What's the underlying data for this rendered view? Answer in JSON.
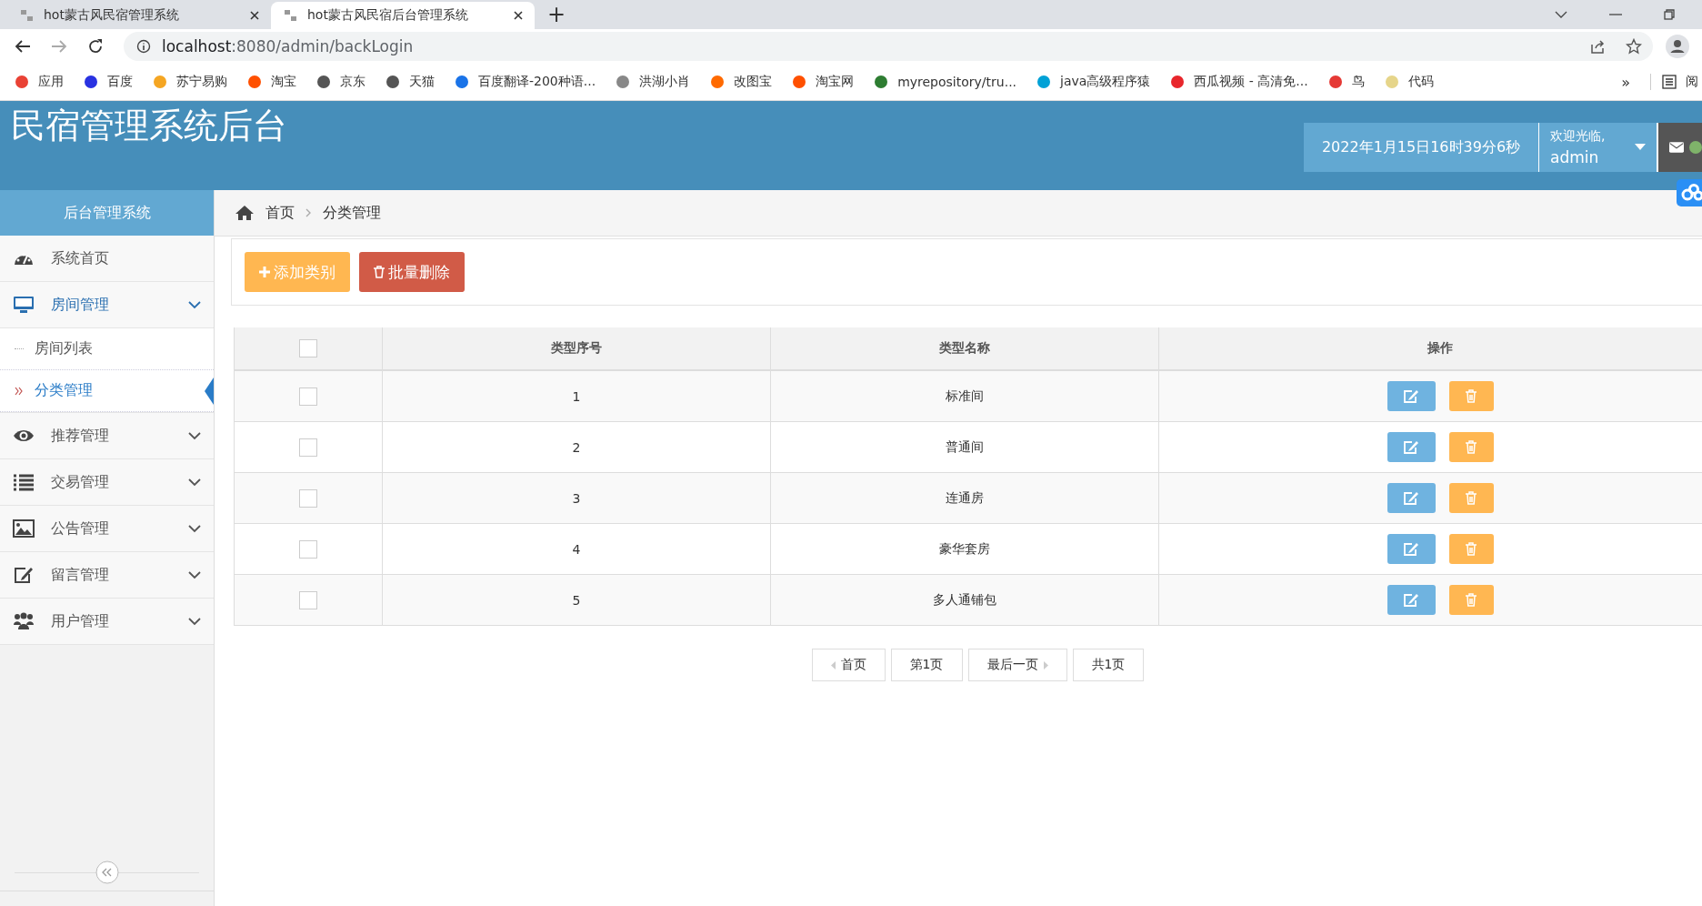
{
  "browser": {
    "tabs": [
      {
        "title": "hot蒙古风民宿管理系统",
        "selected": false
      },
      {
        "title": "hot蒙古风民宿后台管理系统",
        "selected": true
      }
    ],
    "new_tab": "+",
    "url": {
      "host": "localhost",
      "path": ":8080/admin/backLogin"
    },
    "bookmarks": [
      {
        "label": "应用",
        "color": "#e94235"
      },
      {
        "label": "百度",
        "color": "#2932e1"
      },
      {
        "label": "苏宁易购",
        "color": "#f5a623"
      },
      {
        "label": "淘宝",
        "color": "#ff5000"
      },
      {
        "label": "京东",
        "color": "#555555"
      },
      {
        "label": "天猫",
        "color": "#555555"
      },
      {
        "label": "百度翻译-200种语...",
        "color": "#1a73e8"
      },
      {
        "label": "洪湖小肖",
        "color": "#888888"
      },
      {
        "label": "改图宝",
        "color": "#ff6a00"
      },
      {
        "label": "淘宝网",
        "color": "#ff5000"
      },
      {
        "label": "myrepository/tru...",
        "color": "#2e7d32"
      },
      {
        "label": "java高级程序猿",
        "color": "#00a1d6"
      },
      {
        "label": "西瓜视频 - 高清免...",
        "color": "#e8262c"
      },
      {
        "label": "鸟",
        "color": "#e53935"
      },
      {
        "label": "代码",
        "color": "#e6d58a"
      }
    ],
    "more": "»",
    "reading_list": "阅"
  },
  "header": {
    "title": "民宿管理系统后台",
    "datetime": "2022年1月15日16时39分6秒",
    "welcome": "欢迎光临,",
    "user": "admin"
  },
  "sidebar": {
    "title": "后台管理系统",
    "items": [
      {
        "label": "系统首页",
        "kind": "gauge",
        "selected": false,
        "collapsible": false
      },
      {
        "label": "房间管理",
        "kind": "monitor",
        "selected": true,
        "collapsible": true,
        "children": [
          {
            "label": "房间列表",
            "selected": false
          },
          {
            "label": "分类管理",
            "selected": true
          }
        ]
      },
      {
        "label": "推荐管理",
        "kind": "eye",
        "selected": false,
        "collapsible": true
      },
      {
        "label": "交易管理",
        "kind": "list",
        "selected": false,
        "collapsible": true
      },
      {
        "label": "公告管理",
        "kind": "image",
        "selected": false,
        "collapsible": true
      },
      {
        "label": "留言管理",
        "kind": "edit",
        "selected": false,
        "collapsible": true
      },
      {
        "label": "用户管理",
        "kind": "users",
        "selected": false,
        "collapsible": true
      }
    ]
  },
  "breadcrumb": [
    "首页",
    "分类管理"
  ],
  "toolbar": {
    "add": "添加类别",
    "batch_delete": "批量删除"
  },
  "table": {
    "columns": [
      "类型序号",
      "类型名称",
      "操作"
    ],
    "all_checked": false,
    "rows": [
      {
        "id": "1",
        "name": "标准间",
        "checked": false
      },
      {
        "id": "2",
        "name": "普通间",
        "checked": false
      },
      {
        "id": "3",
        "name": "连通房",
        "checked": false
      },
      {
        "id": "4",
        "name": "豪华套房",
        "checked": false
      },
      {
        "id": "5",
        "name": "多人通铺包",
        "checked": false
      }
    ]
  },
  "pagination": {
    "first": "首页",
    "current": "第1页",
    "last": "最后一页",
    "total": "共1页"
  }
}
